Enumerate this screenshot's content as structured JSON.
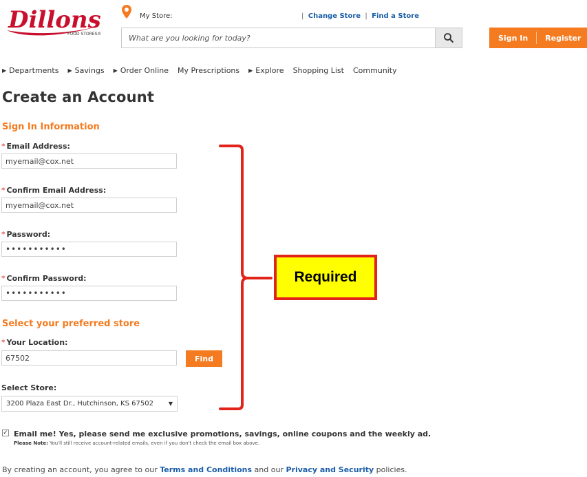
{
  "header": {
    "logo_text": "Dillons",
    "logo_subtext": "FOOD STORES®",
    "my_store_label": "My Store:",
    "sep": "|",
    "change_store": "Change Store",
    "find_store": "Find a Store",
    "search_placeholder": "What are you looking for today?",
    "sign_in": "Sign In",
    "register": "Register"
  },
  "nav": {
    "departments": "Departments",
    "savings": "Savings",
    "order_online": "Order Online",
    "prescriptions": "My Prescriptions",
    "explore": "Explore",
    "shopping_list": "Shopping List",
    "community": "Community"
  },
  "form": {
    "title": "Create an Account",
    "signin_heading": "Sign In Information",
    "required_mark": "*",
    "email_label": "Email Address:",
    "email_value": "myemail@cox.net",
    "confirm_email_label": "Confirm Email Address:",
    "confirm_email_value": "myemail@cox.net",
    "password_label": "Password:",
    "password_value": "•••••••••••",
    "confirm_password_label": "Confirm Password:",
    "confirm_password_value": "•••••••••••",
    "store_heading": "Select your preferred store",
    "location_label": "Your Location:",
    "location_value": "67502",
    "find_button": "Find",
    "select_store_label": "Select Store:",
    "selected_store": "3200 Plaza East Dr., Hutchinson, KS 67502"
  },
  "annotation": {
    "callout_text": "Required",
    "bracket_color": "#e2231a",
    "callout_fill": "#ffff00"
  },
  "opt_in": {
    "checked": true,
    "text": "Email me! Yes, please send me exclusive promotions, savings, online coupons and the weekly ad.",
    "note_label": "Please Note:",
    "note_text": "You'll still receive account-related emails, even if you don't check the email box above."
  },
  "agreement": {
    "prefix": "By creating an account, you agree to our",
    "terms": "Terms and Conditions",
    "middle": "and our",
    "privacy": "Privacy and Security",
    "suffix": "policies."
  },
  "colors": {
    "accent_orange": "#f47b20",
    "link_blue": "#1a5da8",
    "brand_red": "#c8102e"
  }
}
